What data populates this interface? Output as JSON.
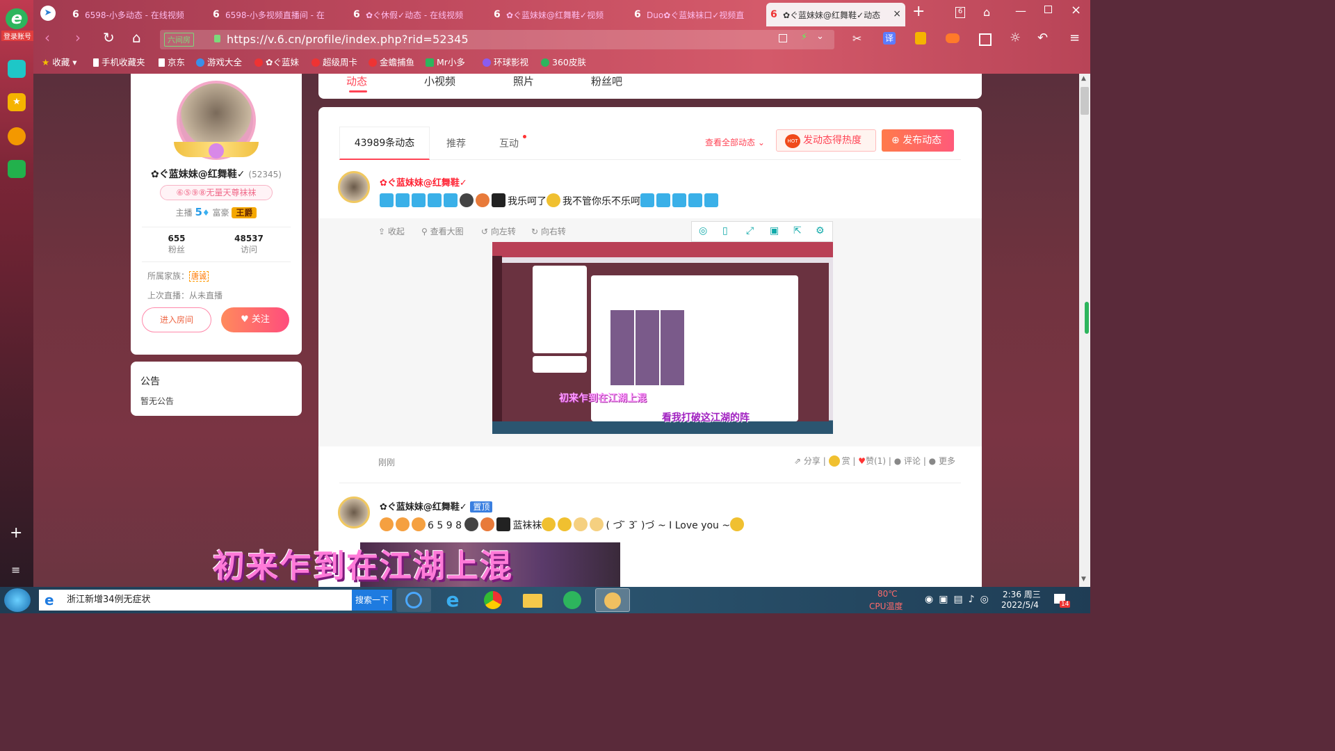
{
  "browser": {
    "tabs": [
      {
        "label": "6598-小多动态 - 在线视频"
      },
      {
        "label": "6598-小多视频直播间 - 在"
      },
      {
        "label": "✿ぐ休假✓动态 - 在线视频"
      },
      {
        "label": "✿ぐ蓝妹妹@红舞鞋✓视频"
      },
      {
        "label": "Duo✿ぐ蓝妹袜口✓视频直"
      },
      {
        "label": "✿ぐ蓝妹妹@红舞鞋✓动态"
      }
    ],
    "tab_count": "6",
    "new_tab": "+",
    "login_label": "登录账号",
    "address_badge": "六间房",
    "url": "https://v.6.cn/profile/index.php?rid=52345",
    "bookmarks": [
      "收藏",
      "手机收藏夹",
      "京东",
      "游戏大全",
      "✿ぐ蓝妹",
      "超级周卡",
      "金蟾捕鱼",
      "Mr小多",
      "环球影视",
      "360皮肤"
    ],
    "translate": "译"
  },
  "profile": {
    "name": "✿ぐ蓝妹妹@红舞鞋✓",
    "rid": "(52345)",
    "title_tag": "⑥⑤⑨⑧无量天尊袜袜",
    "anchor_label": "主播",
    "anchor_level": "5",
    "rich_label": "富豪",
    "rich_badge": "王爵",
    "fans_value": "655",
    "fans_label": "粉丝",
    "visits_value": "48537",
    "visits_label": "访问",
    "family_label": "所属家族：",
    "family_value": "唐诚",
    "last_live": "上次直播：从未直播",
    "enter_room": "进入房间",
    "follow": "关注"
  },
  "notice": {
    "title": "公告",
    "body": "暂无公告"
  },
  "top_tabs": [
    "动态",
    "小视频",
    "照片",
    "粉丝吧"
  ],
  "feed_tabs": [
    "43989条动态",
    "推荐",
    "互动"
  ],
  "feed_actions": {
    "view_all": "查看全部动态",
    "hot": "发动态得热度",
    "hot_badge": "HOT",
    "publish": "发布动态"
  },
  "post1": {
    "author": "✿ぐ蓝妹妹@红舞鞋✓",
    "text1": "我乐呵了",
    "text2": "我不管你乐不乐呵",
    "img_tools": [
      "收起",
      "查看大图",
      "向左转",
      "向右转"
    ],
    "caption_a": "初来乍到在江湖上混",
    "caption_b": "看我打破这江湖的阵",
    "time": "刚刚",
    "share": "分享",
    "reward": "赏",
    "like": "赞(1)",
    "comment": "评论",
    "more": "更多"
  },
  "post2": {
    "author": "✿ぐ蓝妹妹@红舞鞋✓",
    "pin": "置顶",
    "text": "6 5 9 8",
    "text_tail": "蓝袜袜",
    "text_end": "( づ ̄ 3 ̄ )づ ~ I Love you ~",
    "overlay": "初来乍到在江湖上混"
  },
  "taskbar": {
    "news": "浙江新增34例无症状",
    "search_btn": "搜索一下",
    "temp": "80℃",
    "temp_label": "CPU温度",
    "time": "2:36 周三",
    "date": "2022/5/4",
    "notif": "14"
  },
  "colors": {
    "accent": "#ff5a3c",
    "pink": "#ff4d7d",
    "brand_red": "#e6252f"
  }
}
